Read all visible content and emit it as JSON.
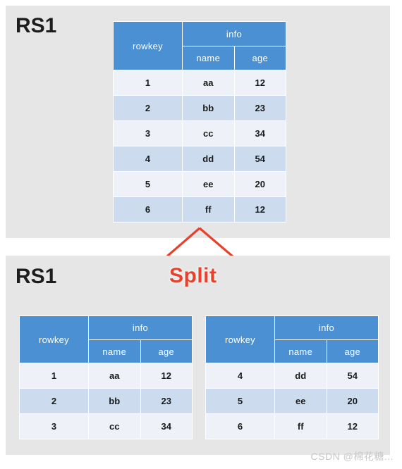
{
  "diagram": {
    "title_top": "RS1",
    "title_bottom": "RS1",
    "split_label": "Split",
    "watermark": "CSDN @棉花糖...",
    "accent_blue": "#4a90d2",
    "arrow_red": "#e8402a",
    "panel_gray": "#e7e6e6",
    "row_odd_bg": "#eef2f8",
    "row_even_bg": "#ccdcee"
  },
  "headers": {
    "rowkey": "rowkey",
    "info": "info",
    "name": "name",
    "age": "age"
  },
  "tables": {
    "original": {
      "rows": [
        {
          "rowkey": "1",
          "name": "aa",
          "age": "12"
        },
        {
          "rowkey": "2",
          "name": "bb",
          "age": "23"
        },
        {
          "rowkey": "3",
          "name": "cc",
          "age": "34"
        },
        {
          "rowkey": "4",
          "name": "dd",
          "age": "54"
        },
        {
          "rowkey": "5",
          "name": "ee",
          "age": "20"
        },
        {
          "rowkey": "6",
          "name": "ff",
          "age": "12"
        }
      ]
    },
    "split_left": {
      "rows": [
        {
          "rowkey": "1",
          "name": "aa",
          "age": "12"
        },
        {
          "rowkey": "2",
          "name": "bb",
          "age": "23"
        },
        {
          "rowkey": "3",
          "name": "cc",
          "age": "34"
        }
      ]
    },
    "split_right": {
      "rows": [
        {
          "rowkey": "4",
          "name": "dd",
          "age": "54"
        },
        {
          "rowkey": "5",
          "name": "ee",
          "age": "20"
        },
        {
          "rowkey": "6",
          "name": "ff",
          "age": "12"
        }
      ]
    }
  }
}
